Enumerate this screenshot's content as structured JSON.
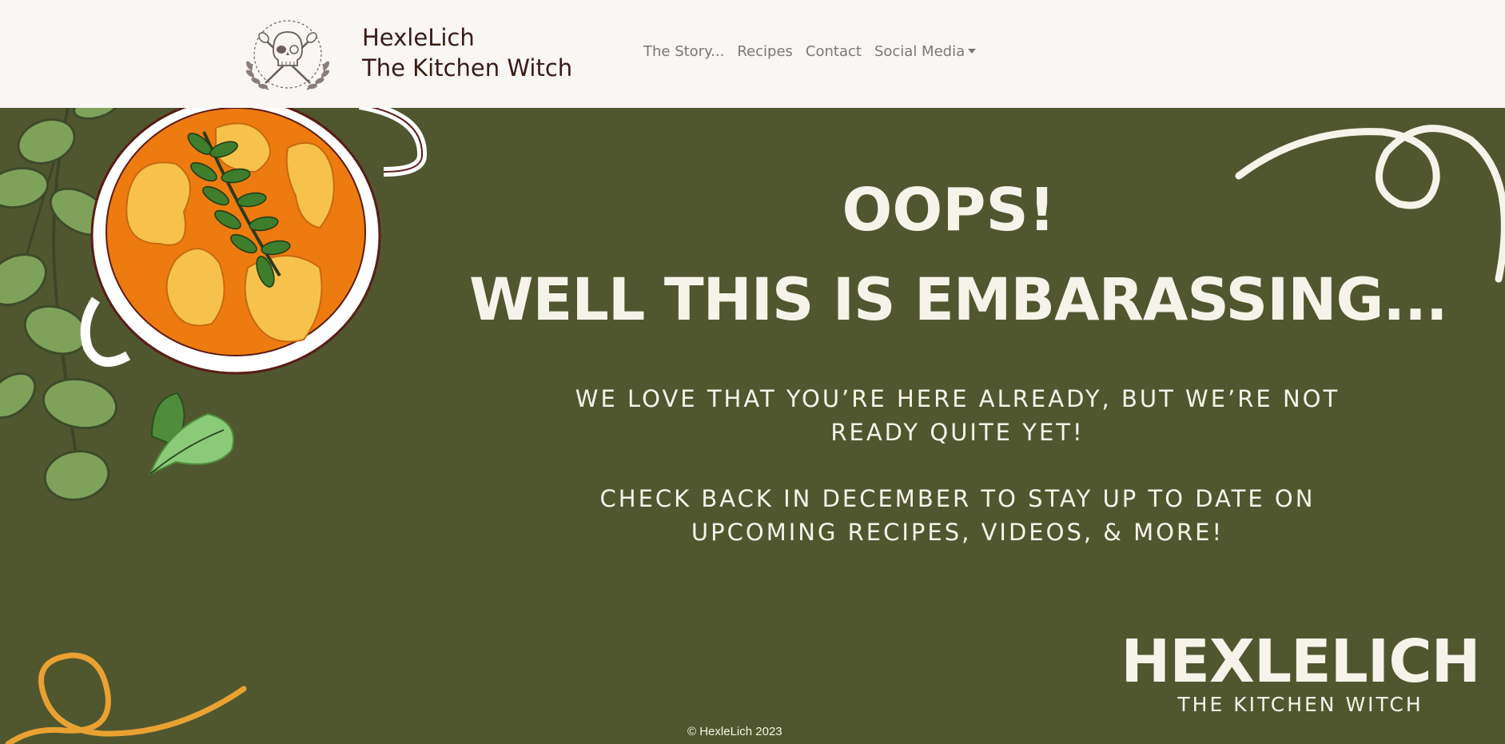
{
  "header": {
    "brand_line1": "HexleLich",
    "brand_line2": "The Kitchen Witch",
    "nav": [
      {
        "label": "The Story..."
      },
      {
        "label": "Recipes"
      },
      {
        "label": "Contact"
      },
      {
        "label": "Social Media"
      }
    ]
  },
  "hero": {
    "title": "OOPS!",
    "subtitle": "WELL THIS IS EMBARASSING...",
    "message_1": "WE LOVE THAT YOU’RE HERE ALREADY, BUT WE’RE NOT READY QUITE YET!",
    "message_2": "CHECK BACK IN DECEMBER TO STAY UP TO DATE ON UPCOMING RECIPES, VIDEOS, & MORE!"
  },
  "footer": {
    "brand_name": "HEXLELICH",
    "brand_tagline": "THE KITCHEN WITCH",
    "copyright": "© HexleLich 2023"
  },
  "colors": {
    "header_bg": "#f9f6f3",
    "hero_bg": "#50572f",
    "text_light": "#f6f4ea",
    "brand_text": "#3a1a16",
    "curry_orange": "#ee7b10",
    "leaf_green": "#7fa25a",
    "swirl_yellow": "#e9a232"
  },
  "icons": {
    "logo": "skull-crossed-spoons-wreath-icon",
    "social_caret": "caret-down-icon"
  }
}
